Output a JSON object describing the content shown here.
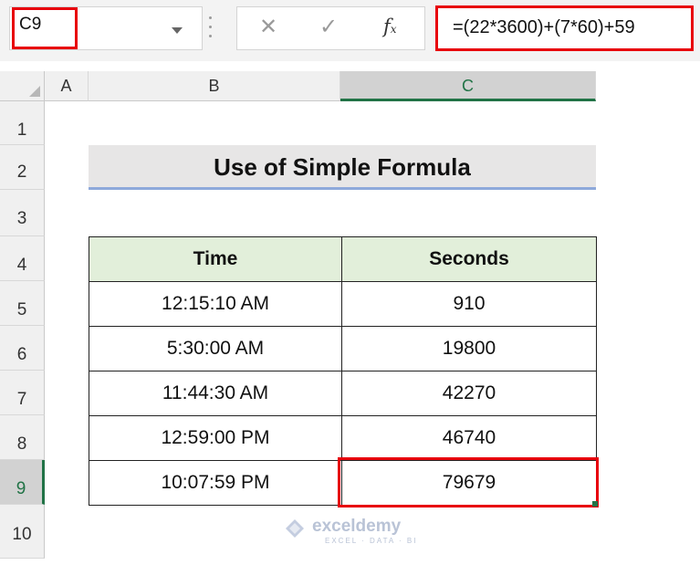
{
  "name_box": {
    "value": "C9"
  },
  "formula_bar": {
    "cancel_glyph": "✕",
    "enter_glyph": "✓",
    "fx_label": "f",
    "fx_sub": "x",
    "formula": "=(22*3600)+(7*60)+59"
  },
  "columns": [
    "A",
    "B",
    "C"
  ],
  "rows": [
    "1",
    "2",
    "3",
    "4",
    "5",
    "6",
    "7",
    "8",
    "9",
    "10"
  ],
  "selected": {
    "column": "C",
    "row": "9"
  },
  "sheet": {
    "title": "Use of Simple Formula",
    "table": {
      "headers": [
        "Time",
        "Seconds"
      ],
      "rows": [
        [
          "12:15:10 AM",
          "910"
        ],
        [
          "5:30:00 AM",
          "19800"
        ],
        [
          "11:44:30 AM",
          "42270"
        ],
        [
          "12:59:00 PM",
          "46740"
        ],
        [
          "10:07:59 PM",
          "79679"
        ]
      ]
    }
  },
  "watermark": {
    "name": "exceldemy",
    "tagline": "EXCEL · DATA · BI"
  },
  "colors": {
    "accent_green": "#217346",
    "highlight_red": "#e8000b",
    "header_fill": "#e2efda",
    "title_fill": "#e7e6e6"
  }
}
